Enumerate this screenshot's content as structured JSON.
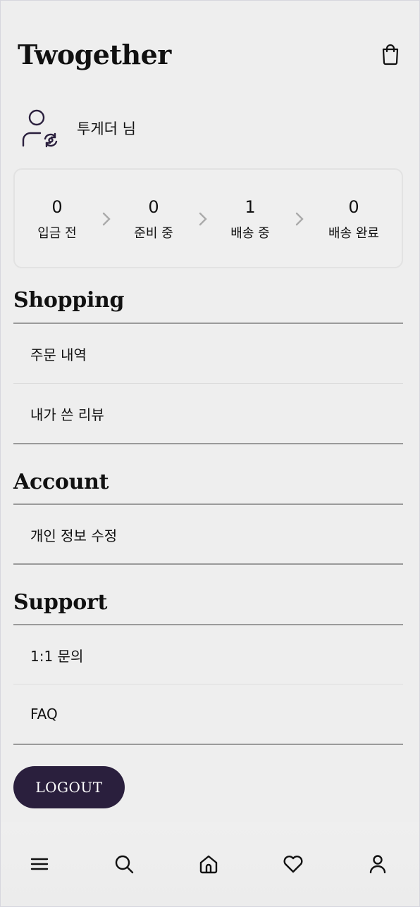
{
  "app": {
    "brand": "Twogether"
  },
  "header": {
    "cart_icon": "shopping-bag-icon"
  },
  "profile": {
    "name": "투게더 님",
    "avatar_icon": "user-switch-icon"
  },
  "order_status": [
    {
      "count": "0",
      "label": "입금 전"
    },
    {
      "count": "0",
      "label": "준비 중"
    },
    {
      "count": "1",
      "label": "배송 중"
    },
    {
      "count": "0",
      "label": "배송 완료"
    }
  ],
  "sections": {
    "shopping": {
      "title": "Shopping",
      "items": [
        "주문 내역",
        "내가 쓴 리뷰"
      ]
    },
    "account": {
      "title": "Account",
      "items": [
        "개인 정보 수정"
      ]
    },
    "support": {
      "title": "Support",
      "items": [
        "1:1 문의",
        "FAQ"
      ]
    }
  },
  "logout": {
    "label": "LOGOUT"
  },
  "bottom_nav": [
    "menu-icon",
    "search-icon",
    "home-icon",
    "heart-icon",
    "user-icon"
  ],
  "colors": {
    "accent": "#2a1f3d",
    "background": "#eeeeee"
  }
}
